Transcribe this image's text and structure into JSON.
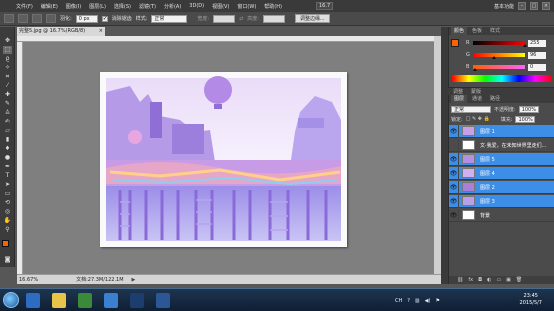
{
  "menubar": {
    "items": [
      "文件(F)",
      "编辑(E)",
      "图像(I)",
      "图层(L)",
      "选择(S)",
      "滤镜(T)",
      "分析(A)",
      "3D(D)",
      "视图(V)",
      "窗口(W)",
      "帮助(H)"
    ],
    "zoom": "16.7",
    "workspace": "基本功能",
    "window_controls": [
      "–",
      "□",
      "×"
    ]
  },
  "options": {
    "feather_label": "羽化:",
    "feather_value": "0 px",
    "antialias_label": "消除锯齿",
    "style_label": "样式:",
    "style_value": "正常",
    "width_label": "宽度:",
    "height_label": "高度:",
    "refine_edge_label": "调整边缘..."
  },
  "document": {
    "tab_title": "完整5.jpg @ 16.7%(RGB/8)",
    "status_zoom": "16.67%",
    "status_doc": "文档:27.3M/122.1M"
  },
  "color_panel": {
    "tabs": [
      "颜色",
      "色板",
      "样式"
    ],
    "sliders": [
      {
        "label": "R",
        "value": "255",
        "fraction": 1.0,
        "gradient": "linear-gradient(to right,#000,#ff0000)"
      },
      {
        "label": "G",
        "value": "96",
        "fraction": 0.376,
        "gradient": "linear-gradient(to right,#ff0000,#ffff00)"
      },
      {
        "label": "B",
        "value": "0",
        "fraction": 0.0,
        "gradient": "linear-gradient(to right,#ff6000,#ff60ff)"
      }
    ],
    "foreground": "#ff6000",
    "background": "#ffffff"
  },
  "adjust_tabs": [
    "调整",
    "蒙版"
  ],
  "layers_panel": {
    "tabs": [
      "图层",
      "通道",
      "路径"
    ],
    "blend_mode": "正常",
    "opacity_label": "不透明度:",
    "opacity": "100%",
    "lock_label": "锁定:",
    "fill_label": "填充:",
    "fill": "100%",
    "layers": [
      {
        "name": "图层 1",
        "visible": true,
        "selected": true,
        "thumb": "#c8a0e8"
      },
      {
        "name": "文·我爱，在未知世界里走们...",
        "visible": false,
        "selected": false,
        "thumb": "#ffffff"
      },
      {
        "name": "图层 5",
        "visible": true,
        "selected": true,
        "thumb": "#b490e0"
      },
      {
        "name": "图层 4",
        "visible": true,
        "selected": true,
        "thumb": "#d0b0f0"
      },
      {
        "name": "图层 2",
        "visible": true,
        "selected": true,
        "thumb": "#a880d8"
      },
      {
        "name": "图层 3",
        "visible": true,
        "selected": true,
        "thumb": "#b8a0e8"
      },
      {
        "name": "背景",
        "visible": true,
        "selected": false,
        "thumb": "#ffffff"
      }
    ],
    "bottom_icons": [
      "link-icon",
      "fx-icon",
      "mask-icon",
      "adjustment-icon",
      "folder-icon",
      "new-layer-icon",
      "trash-icon"
    ],
    "bottom_glyphs": [
      "⛓",
      "fx",
      "◘",
      "◐",
      "▭",
      "▣",
      "🗑"
    ]
  },
  "taskbar": {
    "apps": [
      {
        "name": "maxthon-icon",
        "color": "#2d6cc0"
      },
      {
        "name": "explorer-icon",
        "color": "#e8c34a"
      },
      {
        "name": "media-player-icon",
        "color": "#3a8a3a"
      },
      {
        "name": "pinyin-icon",
        "color": "#3a7fd0"
      },
      {
        "name": "photoshop-icon",
        "color": "#1c3d6e"
      },
      {
        "name": "word-icon",
        "color": "#2b5797"
      }
    ],
    "tray_lang": "CH",
    "time": "23:45",
    "date": "2015/5/7"
  }
}
